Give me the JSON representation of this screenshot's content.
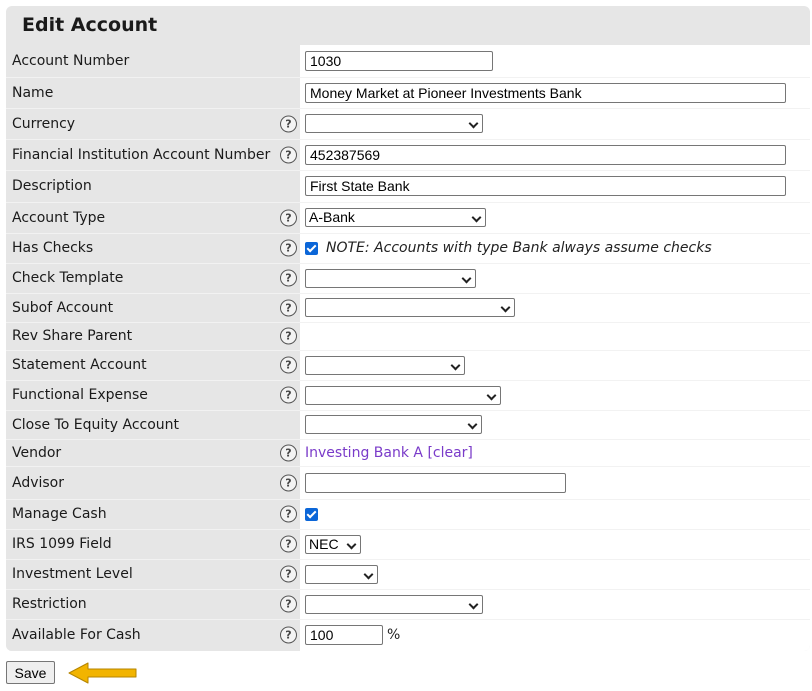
{
  "title": "Edit Account",
  "help_glyph": "?",
  "fields": {
    "account_number": {
      "label": "Account Number",
      "value": "1030"
    },
    "name": {
      "label": "Name",
      "value": "Money Market at Pioneer Investments Bank"
    },
    "currency": {
      "label": "Currency",
      "value": ""
    },
    "fi_account_number": {
      "label": "Financial Institution Account Number",
      "value": "452387569"
    },
    "description": {
      "label": "Description",
      "value": "First State Bank"
    },
    "account_type": {
      "label": "Account Type",
      "value": "A-Bank"
    },
    "has_checks": {
      "label": "Has Checks",
      "checked": true,
      "note": "NOTE: Accounts with type Bank always assume checks"
    },
    "check_template": {
      "label": "Check Template",
      "value": ""
    },
    "subof_account": {
      "label": "Subof Account",
      "value": ""
    },
    "rev_share_parent": {
      "label": "Rev Share Parent"
    },
    "statement_account": {
      "label": "Statement Account",
      "value": ""
    },
    "functional_expense": {
      "label": "Functional Expense",
      "value": ""
    },
    "close_to_equity": {
      "label": "Close To Equity Account",
      "value": ""
    },
    "vendor": {
      "label": "Vendor",
      "link": "Investing Bank A",
      "clear": "[clear]"
    },
    "advisor": {
      "label": "Advisor",
      "value": ""
    },
    "manage_cash": {
      "label": "Manage Cash",
      "checked": true
    },
    "irs_1099": {
      "label": "IRS 1099 Field",
      "value": "NEC"
    },
    "investment_level": {
      "label": "Investment Level",
      "value": ""
    },
    "restriction": {
      "label": "Restriction",
      "value": ""
    },
    "available_for_cash": {
      "label": "Available For Cash",
      "value": "100",
      "unit": "%"
    }
  },
  "save_label": "Save",
  "colors": {
    "link": "#7a3bc9",
    "checkbox": "#0b66d8",
    "arrow": "#f2b400",
    "label_bg": "#e6e6e6"
  }
}
